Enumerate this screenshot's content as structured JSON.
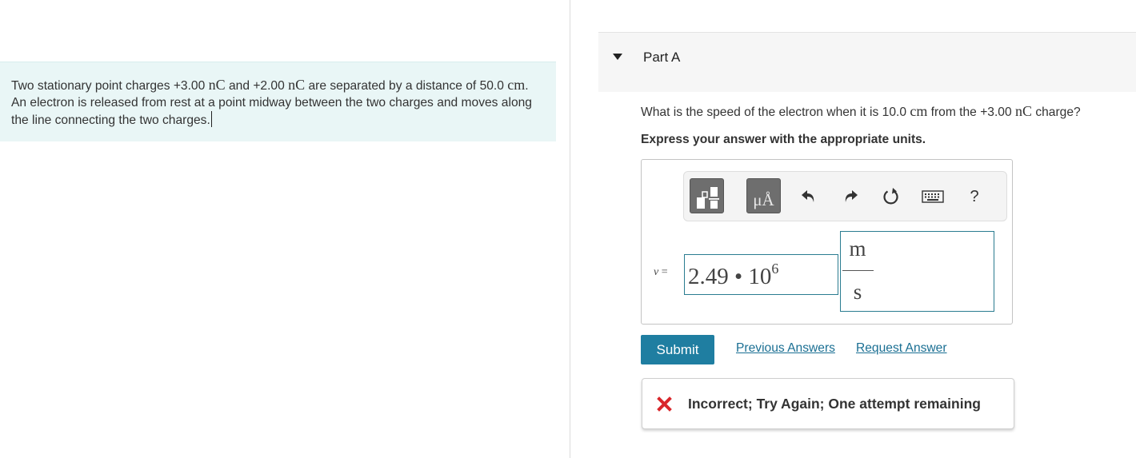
{
  "problem": {
    "text_1": "Two stationary point charges +3.00 ",
    "unit_nc_1": "nC",
    "text_2": " and +2.00 ",
    "unit_nc_2": "nC",
    "text_3": " are separated by a distance of 50.0 ",
    "unit_cm": "cm",
    "text_4": ". An electron is released from rest at a point midway between the two charges and moves along the line connecting the two charges."
  },
  "part": {
    "title": "Part A"
  },
  "question": {
    "text_1": "What is the speed of the electron when it is 10.0 ",
    "unit_cm": "cm",
    "text_2": " from the +3.00 ",
    "unit_nc": "nC",
    "text_3": " charge?"
  },
  "instruction": "Express your answer with the appropriate units.",
  "toolbar": {
    "units_glyph": "μÅ",
    "help_label": "?"
  },
  "answer": {
    "variable": "v",
    "equals": " =",
    "value_mantissa": "2.49 • 10",
    "value_exponent": "6",
    "unit_numerator": "m",
    "unit_denominator": "s"
  },
  "actions": {
    "submit_label": "Submit",
    "previous_answers_label": "Previous Answers",
    "request_answer_label": "Request Answer"
  },
  "feedback": {
    "message": "Incorrect; Try Again; One attempt remaining",
    "icon_color": "#d9262b"
  },
  "colors": {
    "problem_background": "#e9f6f6",
    "link": "#1a6f93",
    "submit": "#1f7ea1",
    "input_border": "#2a7c90"
  }
}
